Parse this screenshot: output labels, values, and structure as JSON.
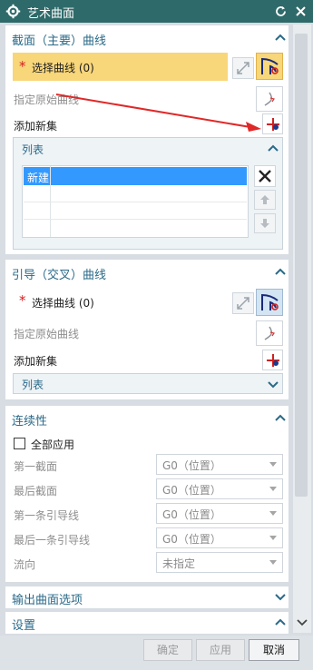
{
  "title": "艺术曲面",
  "section1": {
    "title": "截面（主要）曲线",
    "select_required": "*",
    "select_label": "选择曲线 (0)",
    "origin_label": "指定原始曲线",
    "add_new_set": "添加新集",
    "list_title": "列表",
    "list_rows": [
      "新建",
      "",
      "",
      ""
    ]
  },
  "section2": {
    "title": "引导（交叉）曲线",
    "select_required": "*",
    "select_label": "选择曲线 (0)",
    "origin_label": "指定原始曲线",
    "add_new_set": "添加新集",
    "list_title": "列表"
  },
  "section3": {
    "title": "连续性",
    "apply_all": "全部应用",
    "rows": [
      {
        "label": "第一截面",
        "value": "G0（位置）"
      },
      {
        "label": "最后截面",
        "value": "G0（位置）"
      },
      {
        "label": "第一条引导线",
        "value": "G0（位置）"
      },
      {
        "label": "最后一条引导线",
        "value": "G0（位置）"
      },
      {
        "label": "流向",
        "value": "未指定"
      }
    ]
  },
  "section4": {
    "title": "输出曲面选项"
  },
  "section5": {
    "title": "设置"
  },
  "footer": {
    "ok": "确定",
    "apply": "应用",
    "cancel": "取消"
  },
  "colors": {
    "title_bg": "#2f6a6a",
    "highlight": "#f8d67a",
    "accent": "#2a6a88",
    "selection": "#3399ff",
    "annotation_arrow": "#e02828"
  }
}
